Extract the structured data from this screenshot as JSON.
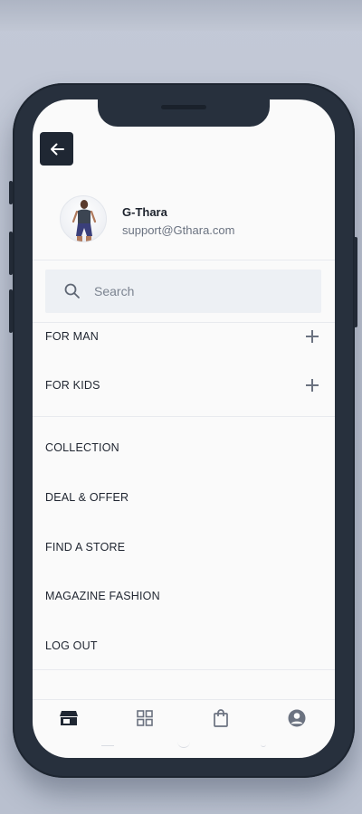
{
  "header": {
    "back_icon": "arrow-left-icon"
  },
  "profile": {
    "name": "G-Thara",
    "email": "support@Gthara.com"
  },
  "search": {
    "placeholder": "Search",
    "icon": "search-icon"
  },
  "expandable_menu": [
    {
      "label": "FOR MAN",
      "icon": "plus-icon"
    },
    {
      "label": "FOR KIDS",
      "icon": "plus-icon"
    }
  ],
  "menu": [
    {
      "label": "COLLECTION"
    },
    {
      "label": "DEAL & OFFER"
    },
    {
      "label": "FIND A STORE"
    },
    {
      "label": "MAGAZINE FASHION"
    },
    {
      "label": "LOG OUT"
    }
  ],
  "bottom_nav": [
    {
      "name": "store-icon"
    },
    {
      "name": "grid-icon"
    },
    {
      "name": "shopping-bag-icon"
    },
    {
      "name": "user-icon"
    }
  ],
  "colors": {
    "background": "#c1c7d4",
    "phone_frame": "#27303d",
    "screen": "#fafafa",
    "search_bg": "#edf0f4",
    "text_dark": "#1f2530",
    "text_muted": "#6a7280"
  }
}
